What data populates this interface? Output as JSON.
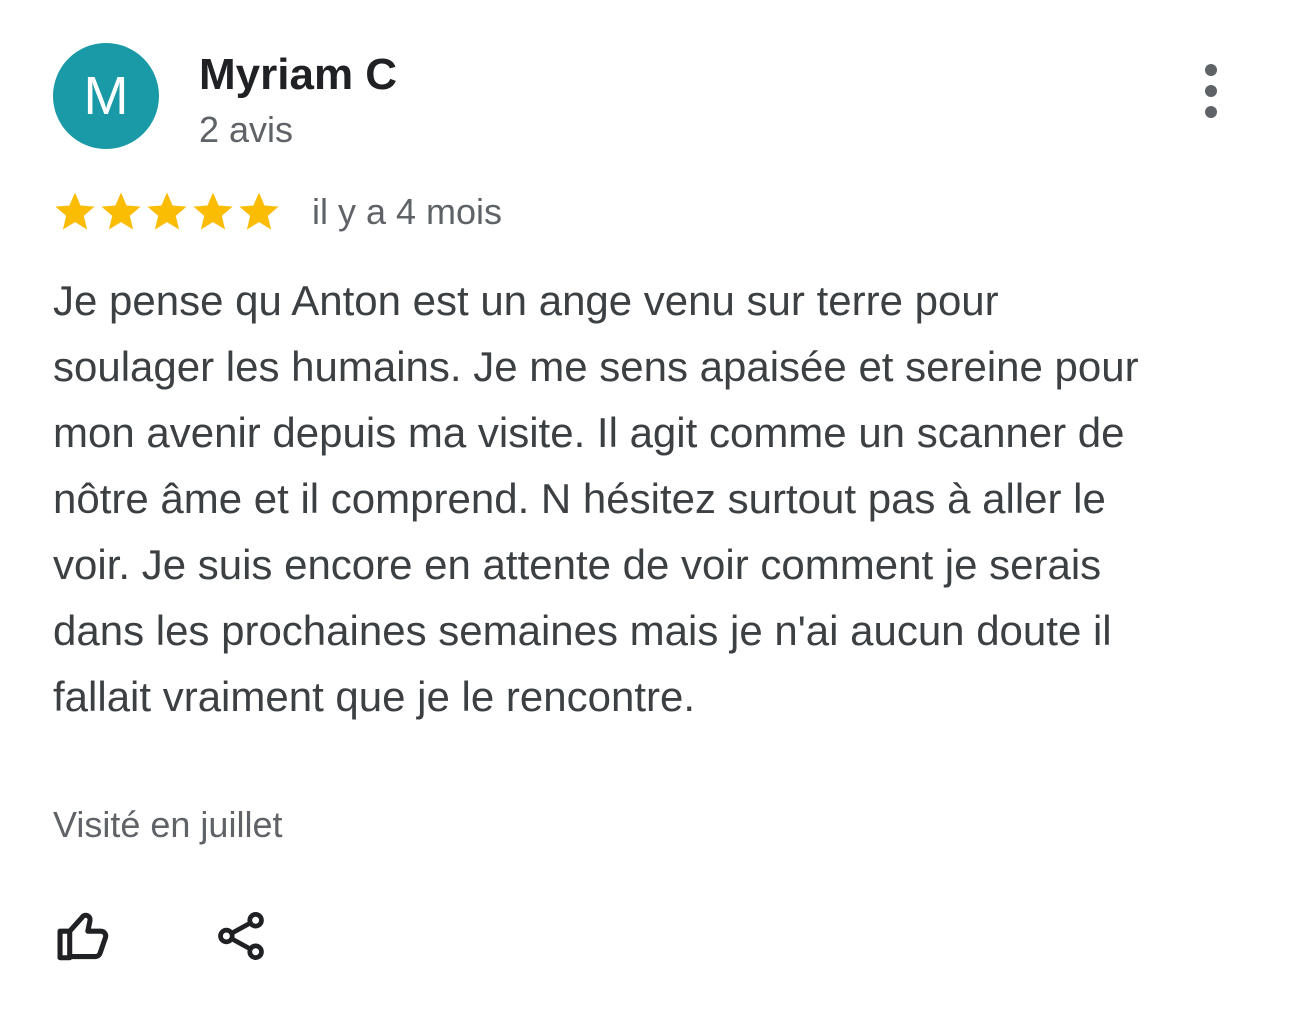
{
  "review": {
    "author": {
      "initial": "M",
      "name": "Myriam C",
      "review_count": "2 avis",
      "avatar_color": "#1a9aa6"
    },
    "rating": 5,
    "rating_max": 5,
    "star_color": "#fbbc04",
    "timestamp": "il y a 4 mois",
    "text": "Je pense qu Anton est un ange venu sur terre pour soulager les humains. Je me sens apaisée et sereine pour mon avenir depuis ma visite. Il agit comme un scanner de nôtre âme et il comprend. N hésitez surtout pas à aller le voir. Je suis encore en attente de voir comment je serais dans les prochaines semaines mais je n'ai aucun doute il fallait vraiment que je le rencontre.",
    "visit_info": "Visité en juillet"
  },
  "icons": {
    "menu": "more-vert-icon",
    "like": "thumbs-up-icon",
    "share": "share-icon",
    "star": "star-icon"
  }
}
